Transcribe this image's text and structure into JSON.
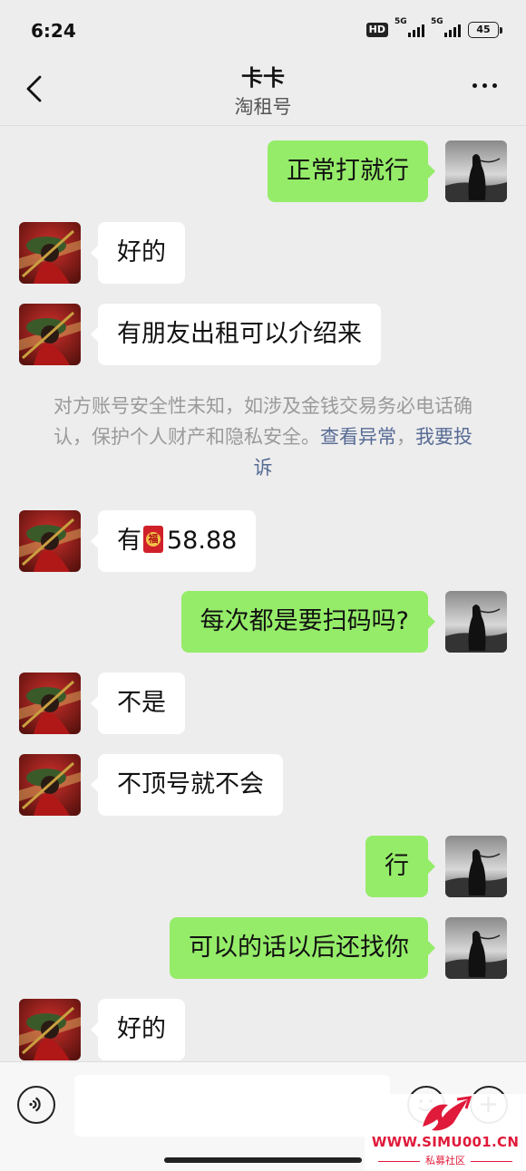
{
  "status_bar": {
    "time": "6:24",
    "hd": "HD",
    "network_1": "5G",
    "network_2": "5G",
    "battery": "45"
  },
  "header": {
    "title": "卡卡",
    "subtitle": "淘租号"
  },
  "messages": [
    {
      "side": "right",
      "text": "正常打就行"
    },
    {
      "side": "left",
      "text": "好的"
    },
    {
      "side": "left",
      "text": "有朋友出租可以介绍来"
    },
    {
      "side": "left",
      "text_prefix": "有",
      "text_suffix": "58.88",
      "icon": "red-packet-icon"
    },
    {
      "side": "right",
      "text": "每次都是要扫码吗?"
    },
    {
      "side": "left",
      "text": "不是"
    },
    {
      "side": "left",
      "text": "不顶号就不会"
    },
    {
      "side": "right",
      "text": "行"
    },
    {
      "side": "right",
      "text": "可以的话以后还找你"
    },
    {
      "side": "left",
      "text": "好的"
    }
  ],
  "system_notice": {
    "text": "对方账号安全性未知，如涉及金钱交易务必电话确认，保护个人财产和隐私安全。",
    "link_view": "查看异常",
    "separator": "，",
    "link_report": "我要投诉"
  },
  "input_bar": {
    "placeholder": ""
  },
  "watermark": {
    "url": "WWW.SIMU001.CN",
    "sub": "私募社区"
  },
  "colors": {
    "background": "#ededed",
    "bubble_sent": "#95ec69",
    "bubble_received": "#ffffff",
    "link": "#576b95",
    "notice_text": "#9a9a9a",
    "watermark": "#e01a3a"
  }
}
